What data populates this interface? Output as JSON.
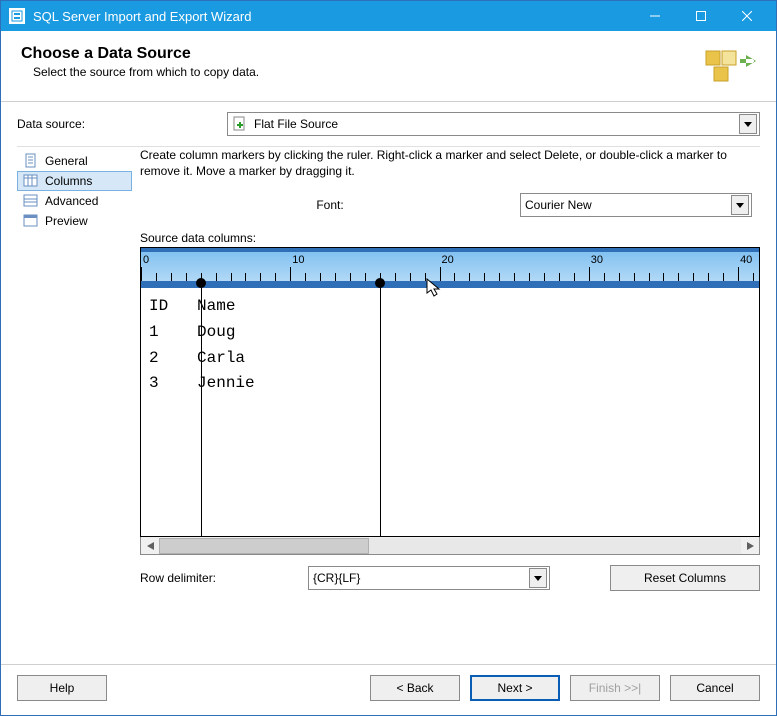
{
  "window": {
    "title": "SQL Server Import and Export Wizard"
  },
  "header": {
    "title": "Choose a Data Source",
    "subtitle": "Select the source from which to copy data."
  },
  "data_source": {
    "label": "Data source:",
    "value": "Flat File Source"
  },
  "nav": {
    "items": [
      {
        "label": "General",
        "selected": false
      },
      {
        "label": "Columns",
        "selected": true
      },
      {
        "label": "Advanced",
        "selected": false
      },
      {
        "label": "Preview",
        "selected": false
      }
    ]
  },
  "instructions": "Create column markers by clicking the ruler. Right-click a marker and select Delete, or double-click a marker to remove it. Move a marker by dragging it.",
  "font": {
    "label": "Font:",
    "value": "Courier New"
  },
  "source_columns": {
    "label": "Source data columns:",
    "ruler_ticks": [
      "0",
      "10",
      "20",
      "30",
      "40"
    ],
    "markers": [
      4,
      16
    ],
    "rows": [
      "ID   Name",
      "1    Doug",
      "2    Carla",
      "3    Jennie"
    ]
  },
  "row_delimiter": {
    "label": "Row delimiter:",
    "value": "{CR}{LF}"
  },
  "buttons": {
    "reset_columns": "Reset Columns",
    "help": "Help",
    "back": "< Back",
    "next": "Next >",
    "finish": "Finish >>|",
    "cancel": "Cancel"
  }
}
